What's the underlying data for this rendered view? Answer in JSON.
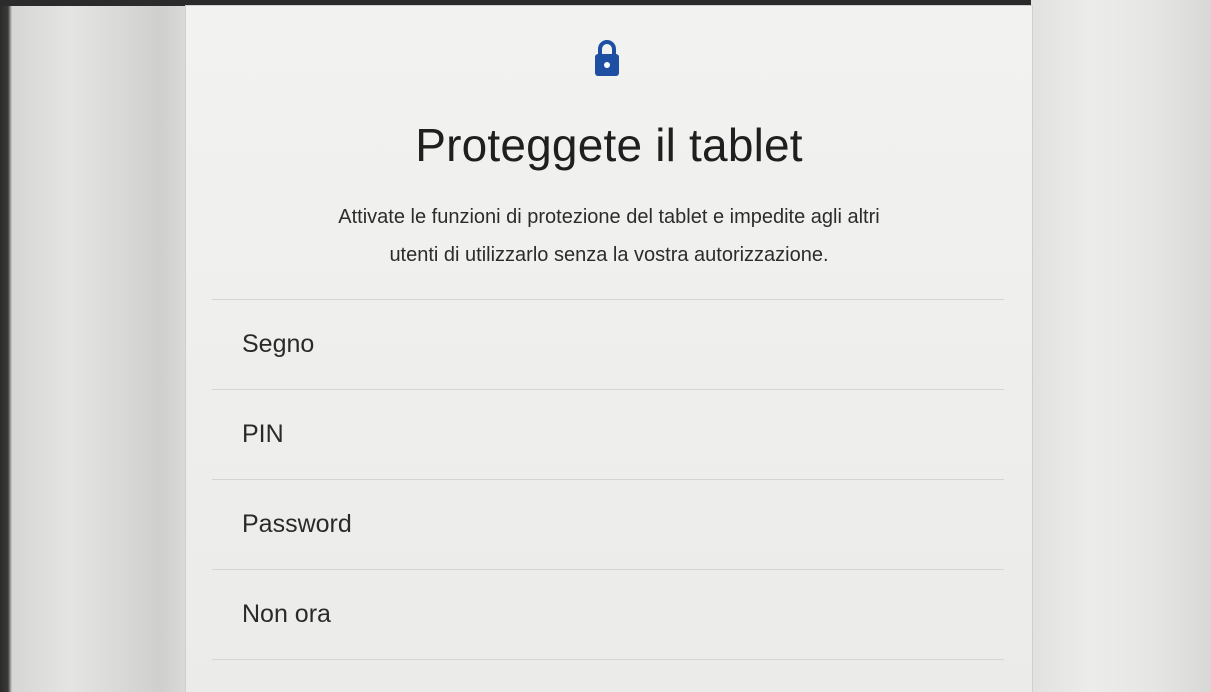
{
  "header": {
    "icon": "lock-icon",
    "accent_color": "#1e4fa3",
    "title": "Proteggete il tablet",
    "subtitle_line1": "Attivate le funzioni di protezione del tablet e impedite agli altri",
    "subtitle_line2": "utenti di utilizzarlo senza la vostra autorizzazione."
  },
  "options": [
    {
      "label": "Segno"
    },
    {
      "label": "PIN"
    },
    {
      "label": "Password"
    },
    {
      "label": "Non ora"
    }
  ]
}
